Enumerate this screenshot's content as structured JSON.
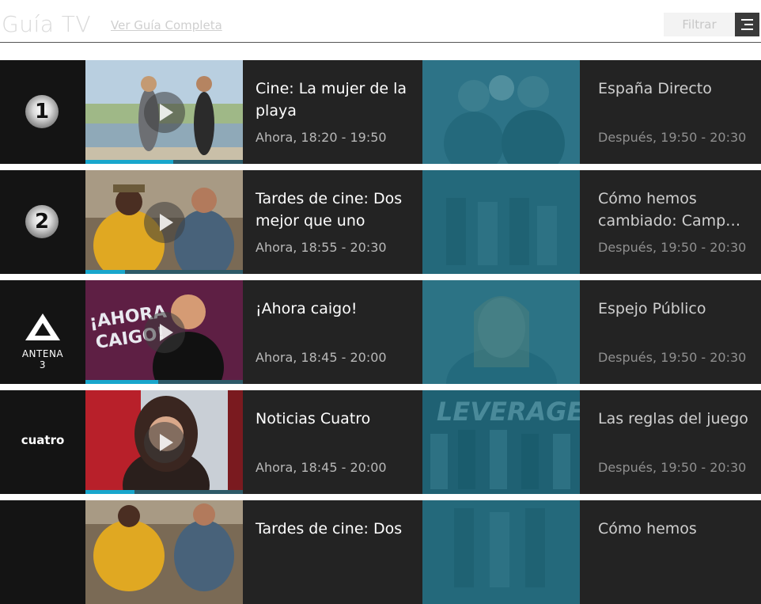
{
  "header": {
    "title": "Guía TV",
    "full_guide_link": "Ver Guía Completa",
    "filter_label": "Filtrar",
    "menu_icon": "menu-icon"
  },
  "colors": {
    "row_bg": "#232323",
    "logo_bg": "#141414",
    "progress": "#18a6cc",
    "next_tint": "#1a697d"
  },
  "channels": [
    {
      "logo_text": "1",
      "now": {
        "title": "Cine: La mujer de la playa",
        "time": "Ahora, 18:20 - 19:50",
        "progress": 0.56
      },
      "next": {
        "title": "España Directo",
        "time": "Después, 19:50 - 20:30"
      }
    },
    {
      "logo_text": "2",
      "now": {
        "title": "Tardes de cine: Dos mejor que uno",
        "time": "Ahora, 18:55 - 20:30",
        "progress": 0.25
      },
      "next": {
        "title": "Cómo hemos cambiado: Camp…",
        "time": "Después, 19:50 - 20:30"
      }
    },
    {
      "logo_text": "ANTENA 3",
      "now": {
        "title": "¡Ahora caigo!",
        "time": "Ahora, 18:45 - 20:00",
        "progress": 0.46
      },
      "next": {
        "title": "Espejo Público",
        "time": "Después, 19:50 - 20:30"
      }
    },
    {
      "logo_text": "cuatro",
      "now": {
        "title": "Noticias Cuatro",
        "time": "Ahora, 18:45 - 20:00",
        "progress": 0.31
      },
      "next": {
        "title": "Las reglas del juego",
        "time": "Después, 19:50 - 20:30"
      }
    },
    {
      "logo_text": "",
      "now": {
        "title": "Tardes de cine: Dos",
        "time": "",
        "progress": 0
      },
      "next": {
        "title": "Cómo hemos",
        "time": ""
      }
    }
  ]
}
